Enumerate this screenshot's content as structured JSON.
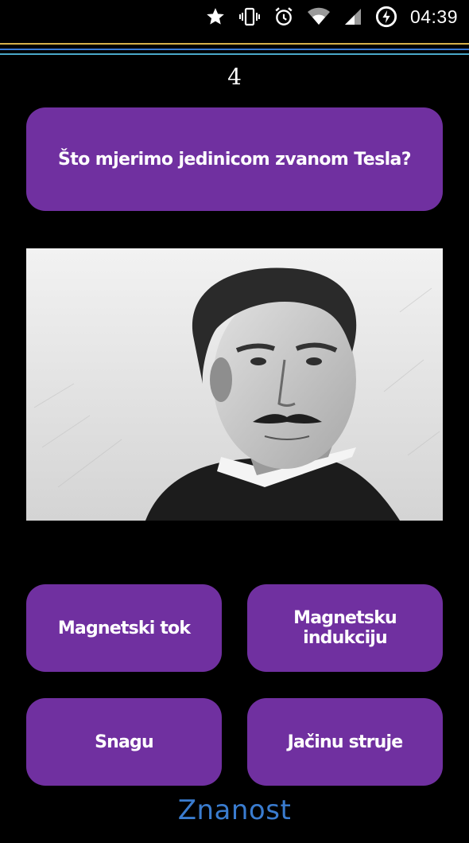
{
  "status_bar": {
    "time": "04:39",
    "icons": [
      "star-icon",
      "vibrate-icon",
      "alarm-icon",
      "wifi-icon",
      "signal-icon",
      "battery-charging-icon"
    ]
  },
  "quiz": {
    "question_number": "4",
    "question": "Što mjerimo jedinicom zvanom Tesla?",
    "answers": [
      "Magnetski tok",
      "Magnetsku indukciju",
      "Snagu",
      "Jačinu struje"
    ],
    "category": "Znanost"
  },
  "colors": {
    "background": "#000000",
    "button": "#7030a0",
    "category_text": "#3a7ccf",
    "divider_lines": [
      "#d6b04a",
      "#3a7bd5",
      "#4aa8c9"
    ]
  }
}
